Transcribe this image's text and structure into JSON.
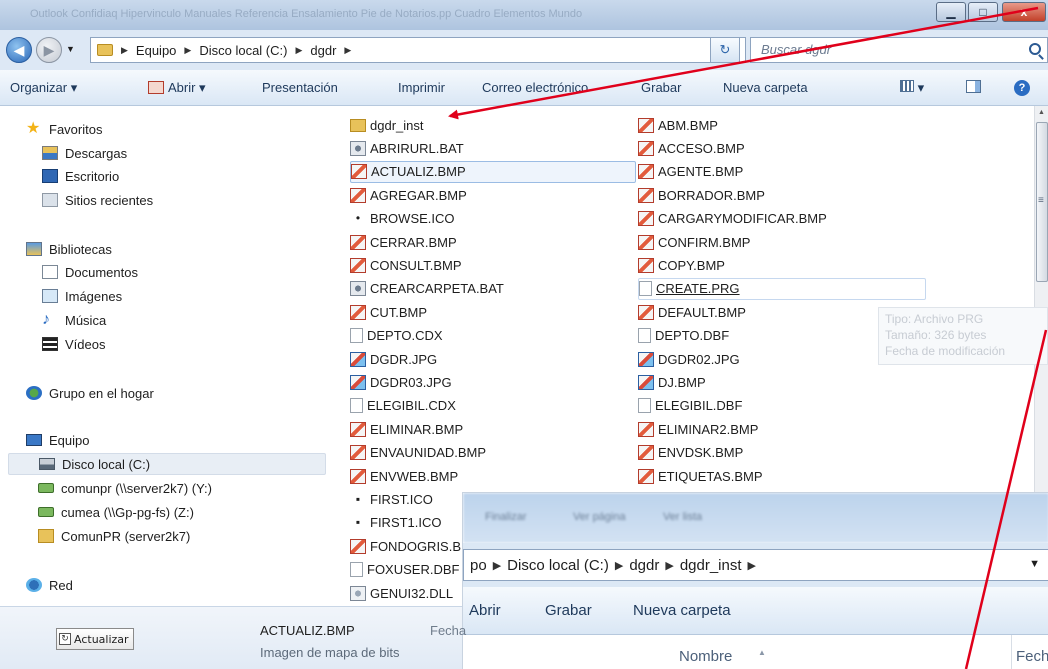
{
  "titlebar": {
    "blurred_text": "Outlook Confidiaq   Hipervinculo Manuales Referencia   Ensalamiento  Pie de   Notarios.pp   Cuadro  Elementos Mundo",
    "minimize": "▁",
    "maximize": "□",
    "close": "x"
  },
  "address": {
    "segments": [
      "Equipo",
      "Disco local (C:)",
      "dgdr"
    ],
    "search_placeholder": "Buscar dgdr",
    "refresh": "↻",
    "dropdown": "▼"
  },
  "toolbar": {
    "organize": "Organizar ▾",
    "open": "Abrir ▾",
    "items": [
      "Presentación",
      "Imprimir",
      "Correo electrónico",
      "Grabar",
      "Nueva carpeta"
    ],
    "view_caret": "▾",
    "help": "?"
  },
  "nav": {
    "favorites": "Favoritos",
    "fav_items": [
      "Descargas",
      "Escritorio",
      "Sitios recientes"
    ],
    "libraries": "Bibliotecas",
    "lib_items": [
      "Documentos",
      "Imágenes",
      "Música",
      "Vídeos"
    ],
    "homegroup": "Grupo en el hogar",
    "computer": "Equipo",
    "computer_items": [
      "Disco local (C:)",
      "comunpr (\\\\server2k7) (Y:)",
      "cumea (\\\\Gp-pg-fs) (Z:)",
      "ComunPR (server2k7)"
    ],
    "network": "Red"
  },
  "files": {
    "col1": [
      {
        "name": "dgdr_inst",
        "icon": "folder-icon"
      },
      {
        "name": "ABRIRURL.BAT",
        "icon": "batch-file-icon"
      },
      {
        "name": "ACTUALIZ.BMP",
        "icon": "bitmap-file-icon"
      },
      {
        "name": "AGREGAR.BMP",
        "icon": "bitmap-file-icon"
      },
      {
        "name": "BROWSE.ICO",
        "icon": "icon-file-icon"
      },
      {
        "name": "CERRAR.BMP",
        "icon": "bitmap-file-icon"
      },
      {
        "name": "CONSULT.BMP",
        "icon": "bitmap-file-icon"
      },
      {
        "name": "CREARCARPETA.BAT",
        "icon": "batch-file-icon"
      },
      {
        "name": "CUT.BMP",
        "icon": "bitmap-file-icon"
      },
      {
        "name": "DEPTO.CDX",
        "icon": "generic-file-icon"
      },
      {
        "name": "DGDR.JPG",
        "icon": "jpeg-file-icon"
      },
      {
        "name": "DGDR03.JPG",
        "icon": "jpeg-file-icon"
      },
      {
        "name": "ELEGIBIL.CDX",
        "icon": "generic-file-icon"
      },
      {
        "name": "ELIMINAR.BMP",
        "icon": "bitmap-file-icon"
      },
      {
        "name": "ENVAUNIDAD.BMP",
        "icon": "bitmap-file-icon"
      },
      {
        "name": "ENVWEB.BMP",
        "icon": "bitmap-file-icon"
      },
      {
        "name": "FIRST.ICO",
        "icon": "icon-file-icon"
      },
      {
        "name": "FIRST1.ICO",
        "icon": "icon-file-icon"
      },
      {
        "name": "FONDOGRIS.BMP",
        "icon": "bitmap-file-icon"
      },
      {
        "name": "FOXUSER.DBF",
        "icon": "generic-file-icon"
      },
      {
        "name": "GENUI32.DLL",
        "icon": "dll-file-icon"
      }
    ],
    "col2": [
      {
        "name": "ABM.BMP",
        "icon": "bitmap-file-icon"
      },
      {
        "name": "ACCESO.BMP",
        "icon": "bitmap-file-icon"
      },
      {
        "name": "AGENTE.BMP",
        "icon": "bitmap-file-icon"
      },
      {
        "name": "BORRADOR.BMP",
        "icon": "bitmap-file-icon"
      },
      {
        "name": "CARGARYMODIFICAR.BMP",
        "icon": "bitmap-file-icon"
      },
      {
        "name": "CONFIRM.BMP",
        "icon": "bitmap-file-icon"
      },
      {
        "name": "COPY.BMP",
        "icon": "bitmap-file-icon"
      },
      {
        "name": "CREATE.PRG",
        "icon": "generic-file-icon"
      },
      {
        "name": "DEFAULT.BMP",
        "icon": "bitmap-file-icon"
      },
      {
        "name": "DEPTO.DBF",
        "icon": "generic-file-icon"
      },
      {
        "name": "DGDR02.JPG",
        "icon": "jpeg-file-icon"
      },
      {
        "name": "DJ.BMP",
        "icon": "jpeg-file-icon"
      },
      {
        "name": "ELEGIBIL.DBF",
        "icon": "generic-file-icon"
      },
      {
        "name": "ELIMINAR2.BMP",
        "icon": "bitmap-file-icon"
      },
      {
        "name": "ENVDSK.BMP",
        "icon": "bitmap-file-icon"
      },
      {
        "name": "ETIQUETAS.BMP",
        "icon": "bitmap-file-icon"
      }
    ]
  },
  "tooltip": {
    "lines": [
      "Tipo: Archivo PRG",
      "Tamaño: 326 bytes",
      "Fecha de modificación"
    ]
  },
  "inset": {
    "path_segments": [
      "po",
      "Disco local (C:)",
      "dgdr",
      "dgdr_inst"
    ],
    "blurred": [
      "Finalizar",
      "Ver página",
      "Ver lista"
    ],
    "toolbar": [
      "Abrir",
      "Grabar",
      "Nueva carpeta"
    ],
    "columns": [
      "Nombre",
      "Fech"
    ],
    "dropdown": "▼"
  },
  "details": {
    "button_label": "Actualizar",
    "file_name": "ACTUALIZ.BMP",
    "date_label": "Fecha",
    "file_type": "Imagen de mapa de bits"
  },
  "colors": {
    "annotation_arrow": "#e0001b",
    "selection": "#eef4fc",
    "toolbar_text": "#1e395b"
  }
}
